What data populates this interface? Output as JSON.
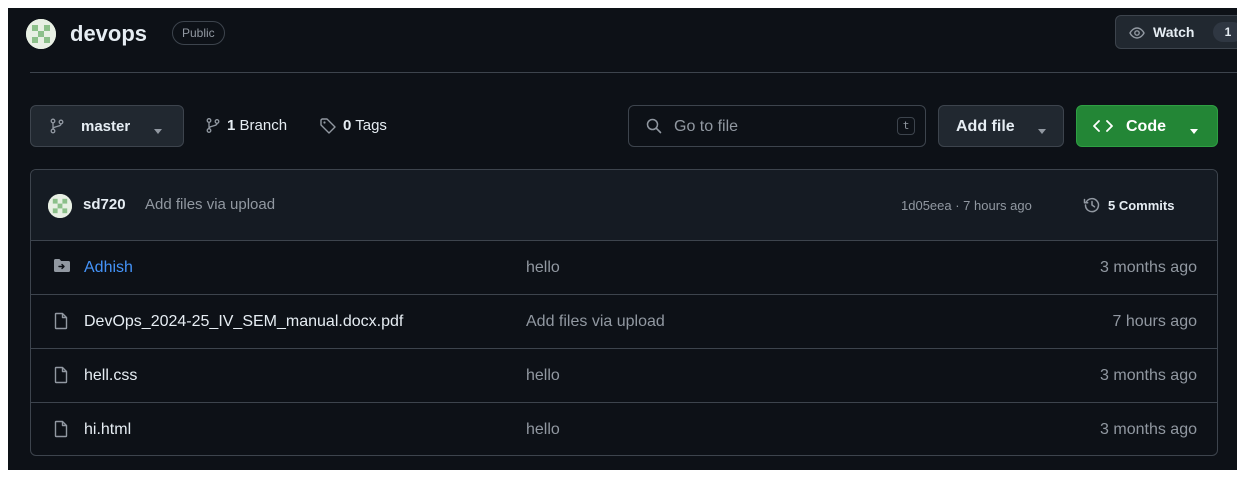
{
  "colors": {
    "background": "#0d1117",
    "border": "#3d444d",
    "text": "#e6edf3",
    "muted": "#9198a1",
    "link": "#4493f8",
    "primary_button": "#238636"
  },
  "header": {
    "avatar_icon": "repo-avatar-icon",
    "repo_name": "devops",
    "visibility": "Public",
    "watch": {
      "icon": "eye-icon",
      "label": "Watch",
      "count": "1"
    }
  },
  "toolbar": {
    "branch_selector": {
      "icon": "git-branch-icon",
      "value": "master",
      "caret": "triangle-down-icon"
    },
    "branch_count": {
      "icon": "git-branch-icon",
      "number": "1",
      "label": "Branch"
    },
    "tag_count": {
      "icon": "tag-icon",
      "number": "0",
      "label": "Tags"
    },
    "go_to_file": {
      "icon": "search-icon",
      "placeholder": "Go to file",
      "shortcut": "t"
    },
    "add_file": {
      "label": "Add file",
      "caret": "triangle-down-icon"
    },
    "code": {
      "icon": "code-icon",
      "label": "Code",
      "caret": "triangle-down-icon"
    }
  },
  "latest_commit": {
    "author": "sd720",
    "message": "Add files via upload",
    "hash_and_time": "1d05eea · 7 hours ago",
    "history_icon": "history-icon",
    "commits_label": "5 Commits"
  },
  "files": [
    {
      "type": "directory",
      "icon": "file-directory-icon",
      "name": "Adhish",
      "message": "hello",
      "date": "3 months ago"
    },
    {
      "type": "file",
      "icon": "file-icon",
      "name": "DevOps_2024-25_IV_SEM_manual.docx.pdf",
      "message": "Add files via upload",
      "date": "7 hours ago"
    },
    {
      "type": "file",
      "icon": "file-icon",
      "name": "hell.css",
      "message": "hello",
      "date": "3 months ago"
    },
    {
      "type": "file",
      "icon": "file-icon",
      "name": "hi.html",
      "message": "hello",
      "date": "3 months ago"
    }
  ]
}
